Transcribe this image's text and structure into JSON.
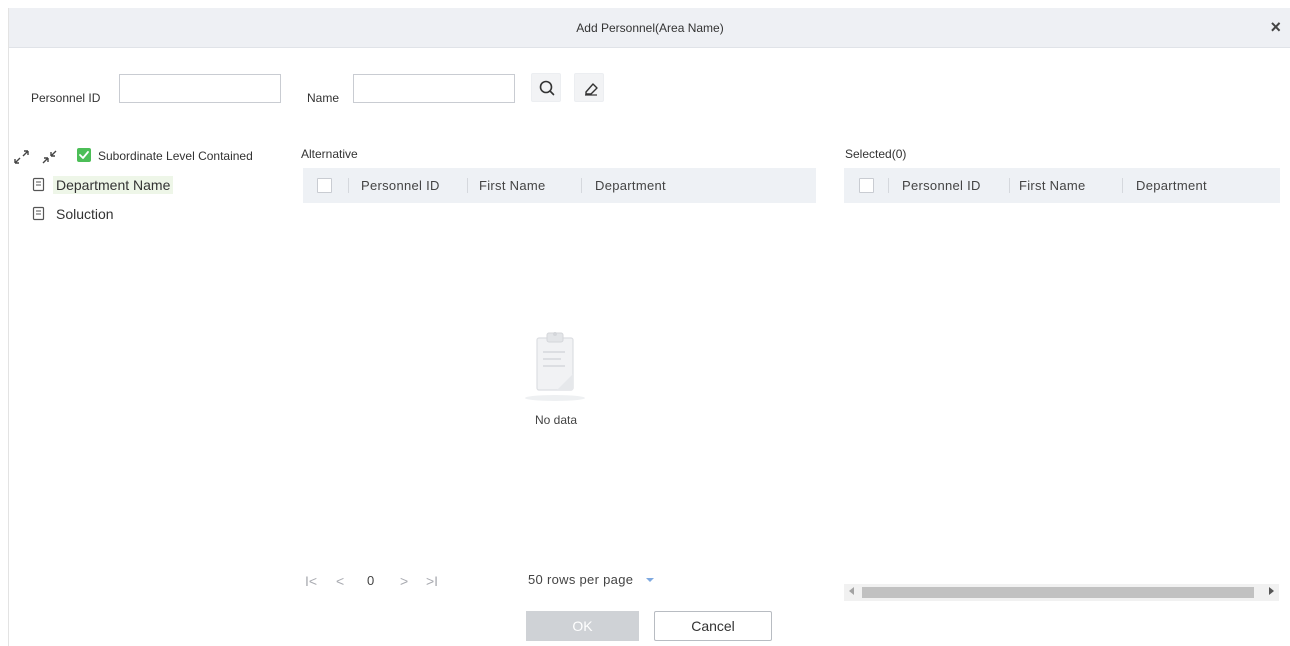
{
  "dialog": {
    "title": "Add Personnel(Area Name)",
    "close_glyph": "×"
  },
  "search": {
    "personnel_id_label": "Personnel ID",
    "personnel_id_value": "",
    "name_label": "Name",
    "name_value": "",
    "search_icon": "search-icon",
    "clear_icon": "eraser-icon"
  },
  "tree": {
    "expand_icon": "expand-icon",
    "collapse_icon": "collapse-icon",
    "subordinate_label": "Subordinate Level Contained",
    "subordinate_checked": true,
    "items": [
      {
        "label": "Department Name",
        "icon": "document-icon",
        "selected": true
      },
      {
        "label": "Soluction",
        "icon": "document-icon",
        "selected": false
      }
    ]
  },
  "alternative": {
    "title": "Alternative",
    "columns": [
      "Personnel ID",
      "First Name",
      "Department"
    ],
    "empty_text": "No data"
  },
  "selected_panel": {
    "title": "Selected(0)",
    "columns": [
      "Personnel ID",
      "First Name",
      "Department"
    ]
  },
  "pagination": {
    "first_glyph": "I<",
    "prev_glyph": "<",
    "page": "0",
    "next_glyph": ">",
    "last_glyph": ">I",
    "rows_per_page": "50 rows per page"
  },
  "footer": {
    "ok_label": "OK",
    "cancel_label": "Cancel"
  },
  "colors": {
    "accent_green": "#4cbe57",
    "header_bg": "#eef1f5"
  }
}
